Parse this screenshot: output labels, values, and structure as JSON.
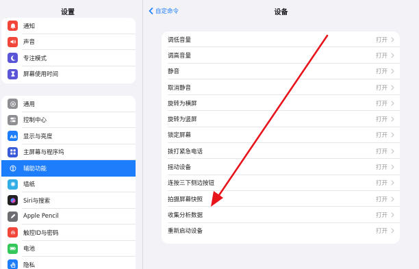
{
  "sidebar": {
    "title": "设置",
    "group1": [
      {
        "label": "通知",
        "icon": "bell-icon",
        "color": "#f2463b"
      },
      {
        "label": "声音",
        "icon": "speaker-icon",
        "color": "#f2463b"
      },
      {
        "label": "专注模式",
        "icon": "moon-icon",
        "color": "#5a55d6"
      },
      {
        "label": "屏幕使用时间",
        "icon": "hourglass-icon",
        "color": "#5a55d6"
      }
    ],
    "group2": [
      {
        "label": "通用",
        "icon": "gear-icon",
        "color": "#8e8e93"
      },
      {
        "label": "控制中心",
        "icon": "toggles-icon",
        "color": "#8e8e93"
      },
      {
        "label": "显示与亮度",
        "icon": "text-size-icon",
        "color": "#1d7dfa"
      },
      {
        "label": "主屏幕与程序坞",
        "icon": "grid-icon",
        "color": "#3a5bd9"
      },
      {
        "label": "辅助功能",
        "icon": "accessibility-icon",
        "color": "#1d7dfa",
        "selected": true
      },
      {
        "label": "墙纸",
        "icon": "flower-icon",
        "color": "#32ade6"
      },
      {
        "label": "Siri与搜索",
        "icon": "siri-icon",
        "color": "#222222"
      },
      {
        "label": "Apple Pencil",
        "icon": "pencil-icon",
        "color": "#6d6d72"
      },
      {
        "label": "触控ID与密码",
        "icon": "fingerprint-icon",
        "color": "#f2463b"
      },
      {
        "label": "电池",
        "icon": "battery-icon",
        "color": "#34c759"
      },
      {
        "label": "隐私",
        "icon": "hand-icon",
        "color": "#1d7dfa"
      }
    ]
  },
  "header": {
    "back_label": "自定命令",
    "title": "设备"
  },
  "main": {
    "rows": [
      {
        "label": "调低音量",
        "value": "打开"
      },
      {
        "label": "调高音量",
        "value": "打开"
      },
      {
        "label": "静音",
        "value": "打开"
      },
      {
        "label": "取消静音",
        "value": "打开"
      },
      {
        "label": "旋转为横屏",
        "value": "打开"
      },
      {
        "label": "旋转为竖屏",
        "value": "打开"
      },
      {
        "label": "锁定屏幕",
        "value": "打开"
      },
      {
        "label": "拨打紧急电话",
        "value": "打开"
      },
      {
        "label": "摇动设备",
        "value": "打开"
      },
      {
        "label": "连按三下侧边按钮",
        "value": "打开"
      },
      {
        "label": "拍摄屏幕快照",
        "value": "打开"
      },
      {
        "label": "收集分析数据",
        "value": "打开"
      },
      {
        "label": "重新启动设备",
        "value": "打开"
      }
    ]
  },
  "annotation": {
    "arrow_color": "#e8141c"
  }
}
